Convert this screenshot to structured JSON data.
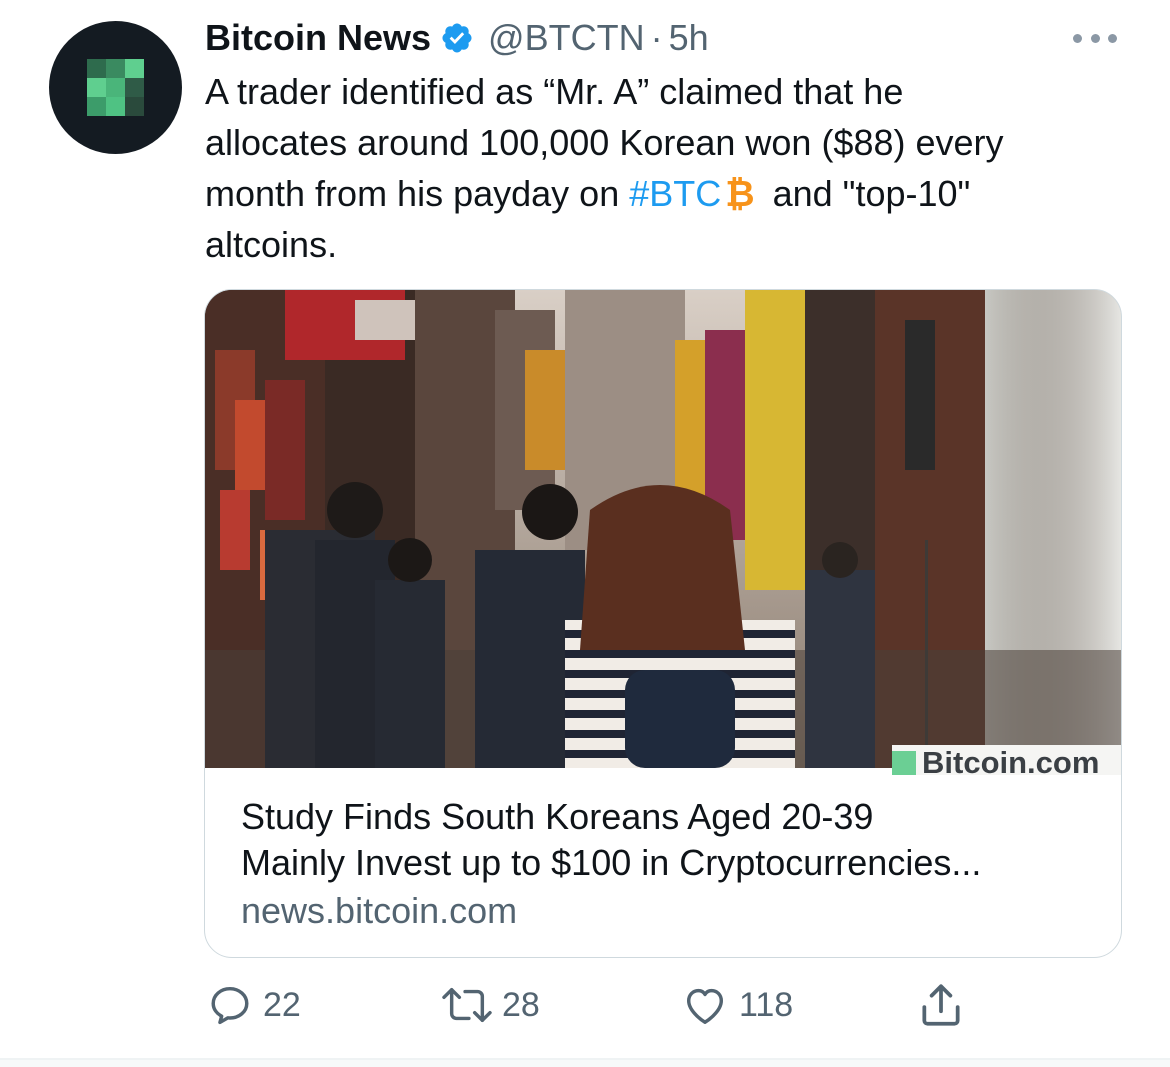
{
  "tweet": {
    "author_name": "Bitcoin News",
    "handle": "@BTCTN",
    "separator": "·",
    "time": "5h",
    "text_lines": [
      "A trader identified as “Mr. A” claimed that he",
      "allocates around 100,000 Korean won ($88) every",
      "month from his payday on",
      "altcoins."
    ],
    "hashtag": "#BTC",
    "btc_symbol": "₿",
    "text_after_hashtag": "and \"top-10\""
  },
  "card": {
    "watermark": "Bitcoin.com",
    "title_lines": [
      "Study Finds South Koreans Aged 20-39",
      "Mainly Invest up to $100 in Cryptocurrencies..."
    ],
    "domain": "news.bitcoin.com"
  },
  "actions": {
    "reply_count": "22",
    "retweet_count": "28",
    "like_count": "118"
  },
  "icons": {
    "avatar": "pixel-grid-logo-icon",
    "verified": "verified-badge-icon",
    "more": "more-options-icon",
    "reply": "reply-icon",
    "retweet": "retweet-icon",
    "like": "heart-icon",
    "share": "share-icon"
  },
  "colors": {
    "accent": "#1d9bf0",
    "secondary_text": "#536471",
    "bitcoin_orange": "#f7931a",
    "avatar_bg": "#141b22",
    "logo_green": "#5fcf8f"
  }
}
